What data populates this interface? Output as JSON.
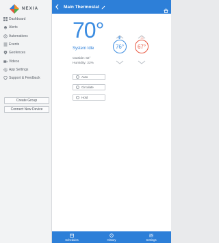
{
  "brand": {
    "logo_text": "NEXIA"
  },
  "sidebar": {
    "items": [
      {
        "label": "Dashboard",
        "icon": "dashboard-icon"
      },
      {
        "label": "Alerts",
        "icon": "bell-icon"
      },
      {
        "label": "Automations",
        "icon": "automation-icon"
      },
      {
        "label": "Events",
        "icon": "events-icon"
      },
      {
        "label": "Geofences",
        "icon": "geofence-icon"
      },
      {
        "label": "Videos",
        "icon": "video-icon"
      },
      {
        "label": "App Settings",
        "icon": "gear-icon"
      },
      {
        "label": "Support & Feedback",
        "icon": "support-icon"
      }
    ],
    "create_group_label": "Create Group",
    "connect_device_label": "Connect New Device"
  },
  "header": {
    "title": "Main Thermostat"
  },
  "thermostat": {
    "current_temp": "70°",
    "status": "System Idle",
    "outside": "Outside: 82°",
    "humidity": "Humidity: 22%",
    "cool_setpoint": "76°",
    "heat_setpoint": "67°"
  },
  "modes": [
    {
      "label": "Auto"
    },
    {
      "label": "Circulate"
    },
    {
      "label": "Hold"
    }
  ],
  "tabs": [
    {
      "label": "Schedules",
      "icon": "calendar-icon"
    },
    {
      "label": "History",
      "icon": "history-icon"
    },
    {
      "label": "Settings",
      "icon": "sliders-icon"
    }
  ],
  "colors": {
    "accent": "#2d7fd8",
    "heat": "#e8553e",
    "background": "#e9eaec"
  }
}
